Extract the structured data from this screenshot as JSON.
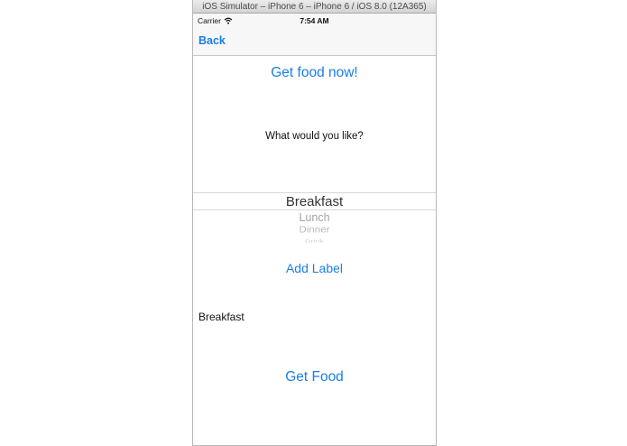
{
  "simulator": {
    "title": "iOS Simulator – iPhone 6 – iPhone 6 / iOS 8.0 (12A365)"
  },
  "status_bar": {
    "carrier": "Carrier",
    "time": "7:54 AM",
    "wifi_icon": "wifi-icon"
  },
  "nav": {
    "back_label": "Back"
  },
  "main": {
    "title_button": "Get food now!",
    "prompt": "What would you like?",
    "picker": {
      "options": [
        "Breakfast",
        "Lunch",
        "Dinner",
        "Drink"
      ],
      "selected": "Breakfast"
    },
    "add_label_button": "Add Label",
    "result_label": "Breakfast",
    "get_food_button": "Get Food"
  },
  "colors": {
    "accent": "#1a7ee6",
    "text": "#111111",
    "bar_bg": "#f7f7f7"
  }
}
